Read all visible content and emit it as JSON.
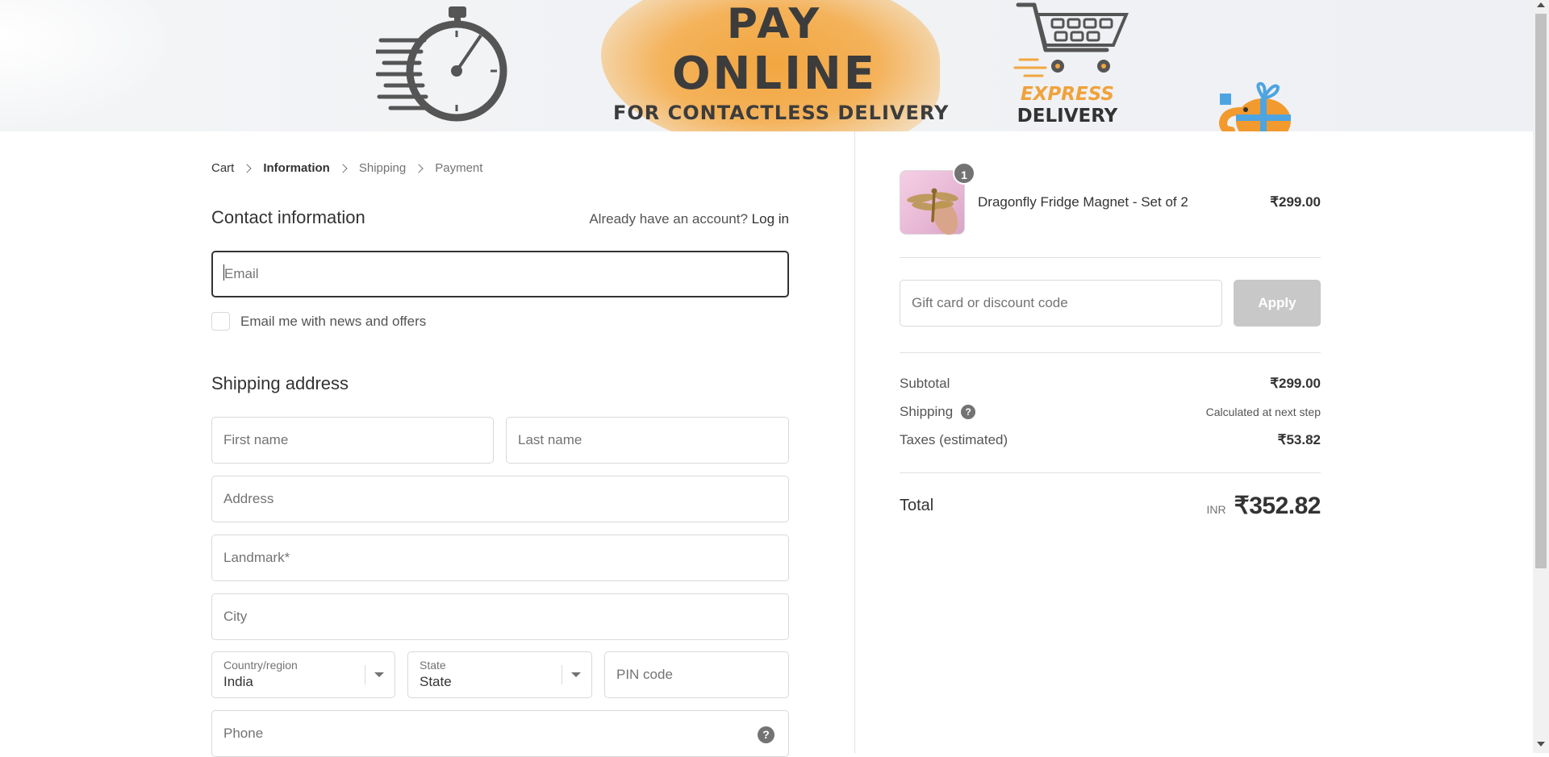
{
  "banner": {
    "line1": "PAY",
    "line2": "ONLINE",
    "line3": "FOR CONTACTLESS DELIVERY",
    "express_line1": "EXPRESS",
    "express_line2": "DELIVERY",
    "accent_color": "#f2a640"
  },
  "breadcrumb": {
    "items": [
      {
        "label": "Cart"
      },
      {
        "label": "Information"
      },
      {
        "label": "Shipping"
      },
      {
        "label": "Payment"
      }
    ]
  },
  "contact": {
    "title": "Contact information",
    "account_prompt": "Already have an account?",
    "login_link": "Log in",
    "email_placeholder": "Email",
    "newsletter_label": "Email me with news and offers"
  },
  "shipping": {
    "title": "Shipping address",
    "first_name_placeholder": "First name",
    "last_name_placeholder": "Last name",
    "address_placeholder": "Address",
    "landmark_placeholder": "Landmark*",
    "city_placeholder": "City",
    "country_label": "Country/region",
    "country_value": "India",
    "state_label": "State",
    "state_value": "State",
    "pin_placeholder": "PIN code",
    "phone_placeholder": "Phone",
    "help_icon": "?"
  },
  "summary": {
    "product": {
      "quantity": "1",
      "name": "Dragonfly Fridge Magnet - Set of 2",
      "price": "₹299.00"
    },
    "discount_placeholder": "Gift card or discount code",
    "apply_label": "Apply",
    "subtotal_label": "Subtotal",
    "subtotal_value": "₹299.00",
    "shipping_label": "Shipping",
    "shipping_value": "Calculated at next step",
    "taxes_label": "Taxes (estimated)",
    "taxes_value": "₹53.82",
    "total_label": "Total",
    "total_currency": "INR",
    "total_value": "₹352.82"
  }
}
